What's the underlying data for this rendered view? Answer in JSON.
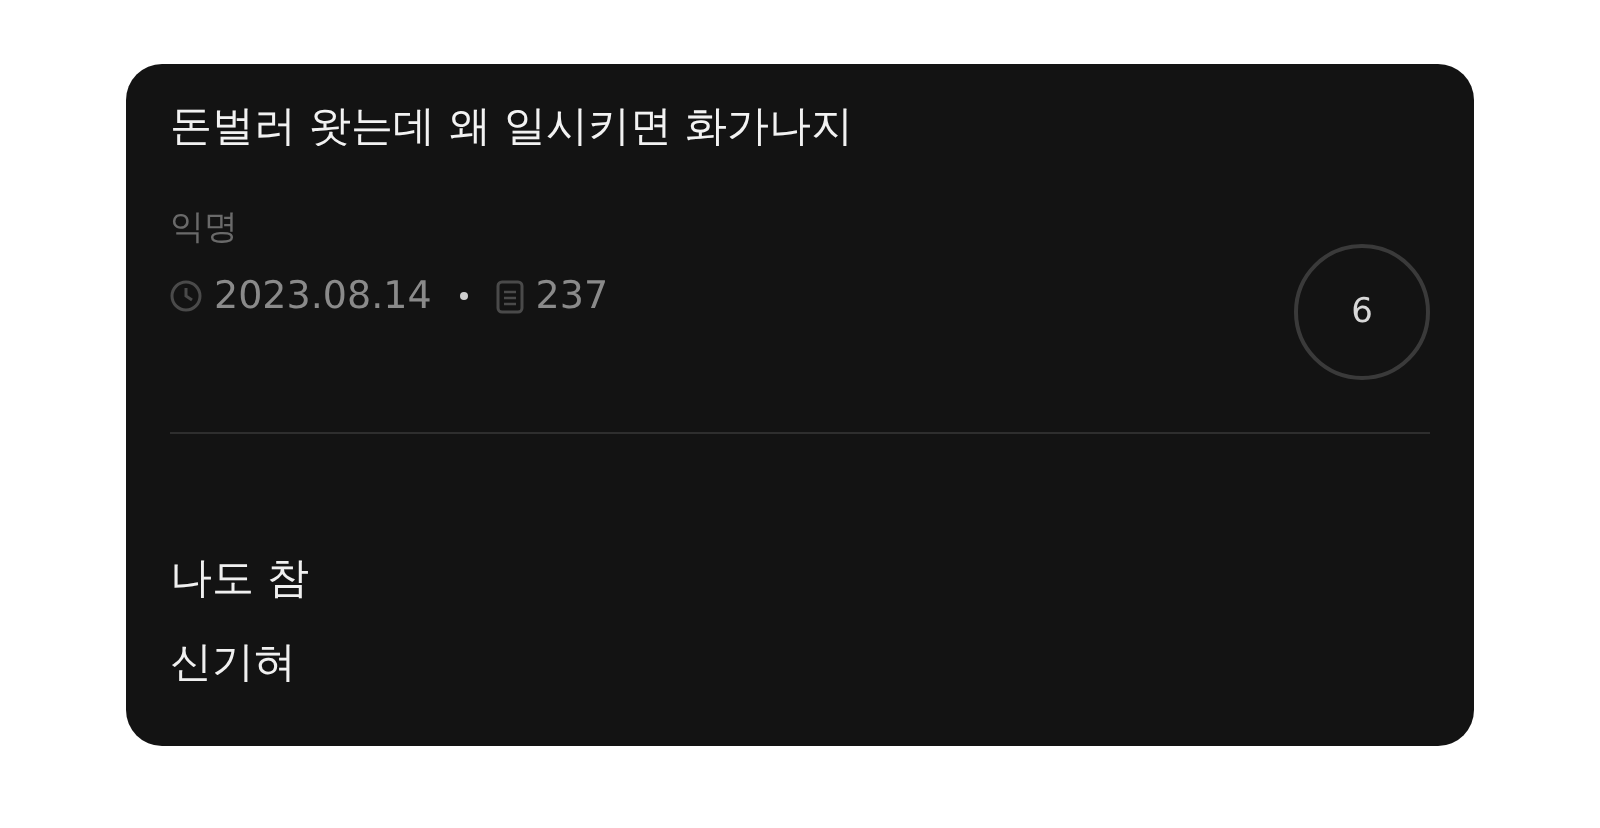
{
  "post": {
    "title": "돈벌러 왓는데 왜 일시키면 화가나지",
    "author": "익명",
    "date": "2023.08.14",
    "views": "237",
    "comment_count": "6",
    "body": [
      "나도 참",
      "신기혀"
    ]
  }
}
